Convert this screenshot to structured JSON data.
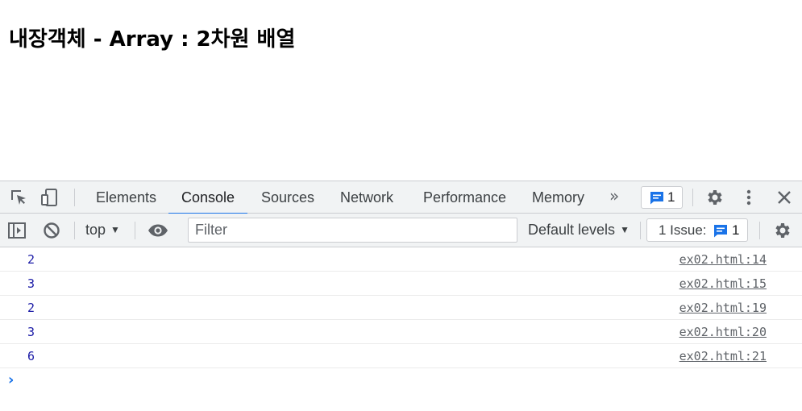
{
  "page": {
    "heading": "내장객체 - Array : 2차원 배열"
  },
  "devtools": {
    "tabs": [
      {
        "label": "Elements",
        "active": false
      },
      {
        "label": "Console",
        "active": true
      },
      {
        "label": "Sources",
        "active": false
      },
      {
        "label": "Network",
        "active": false
      },
      {
        "label": "Performance",
        "active": false
      },
      {
        "label": "Memory",
        "active": false
      }
    ],
    "more_tabs_glyph": "»",
    "messages_badge_count": "1",
    "toolbar": {
      "context": "top",
      "filter_placeholder": "Filter",
      "filter_value": "",
      "levels": "Default levels",
      "issues_label": "1 Issue:",
      "issues_count": "1"
    },
    "console": {
      "rows": [
        {
          "value": "2",
          "source": "ex02.html:14"
        },
        {
          "value": "3",
          "source": "ex02.html:15"
        },
        {
          "value": "2",
          "source": "ex02.html:19"
        },
        {
          "value": "3",
          "source": "ex02.html:20"
        },
        {
          "value": "6",
          "source": "ex02.html:21"
        }
      ],
      "prompt_glyph": "›"
    },
    "colors": {
      "accent": "#1a73e8",
      "log_value": "#1a1aa6",
      "toolbar_bg": "#f1f3f4"
    }
  }
}
